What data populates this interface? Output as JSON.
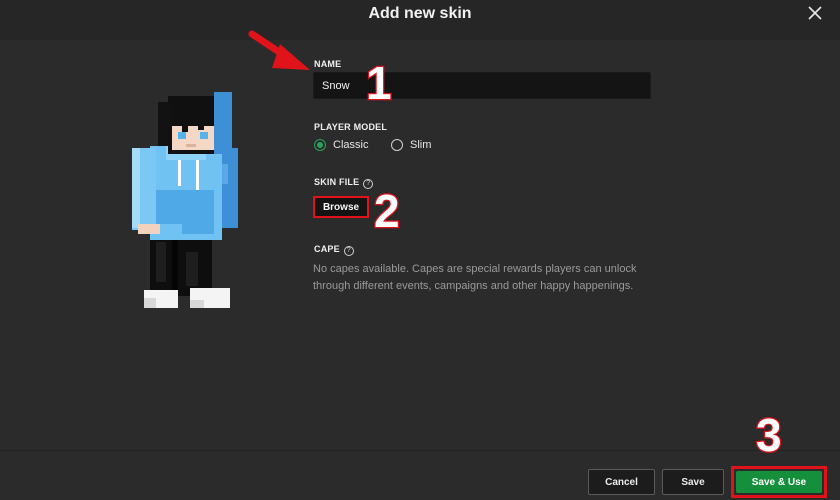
{
  "dialog": {
    "title": "Add new skin"
  },
  "name_field": {
    "label": "NAME",
    "value": "Snow"
  },
  "player_model": {
    "label": "PLAYER MODEL",
    "options": [
      {
        "label": "Classic",
        "selected": true
      },
      {
        "label": "Slim",
        "selected": false
      }
    ]
  },
  "skin_file": {
    "label": "SKIN FILE",
    "browse_label": "Browse"
  },
  "cape": {
    "label": "CAPE",
    "message": "No capes available. Capes are special rewards players can unlock through different events, campaigns and other happy happenings."
  },
  "footer": {
    "cancel_label": "Cancel",
    "save_label": "Save",
    "save_use_label": "Save & Use"
  },
  "annotations": {
    "step1": "1",
    "step2": "2",
    "step3": "3"
  },
  "colors": {
    "accent_green": "#168f3c",
    "highlight_red": "#e0131b",
    "background": "#2b2b2b"
  },
  "icons": {
    "close": "close-icon",
    "help": "help-icon",
    "arrow": "arrow-icon",
    "preview": "skin-preview"
  }
}
